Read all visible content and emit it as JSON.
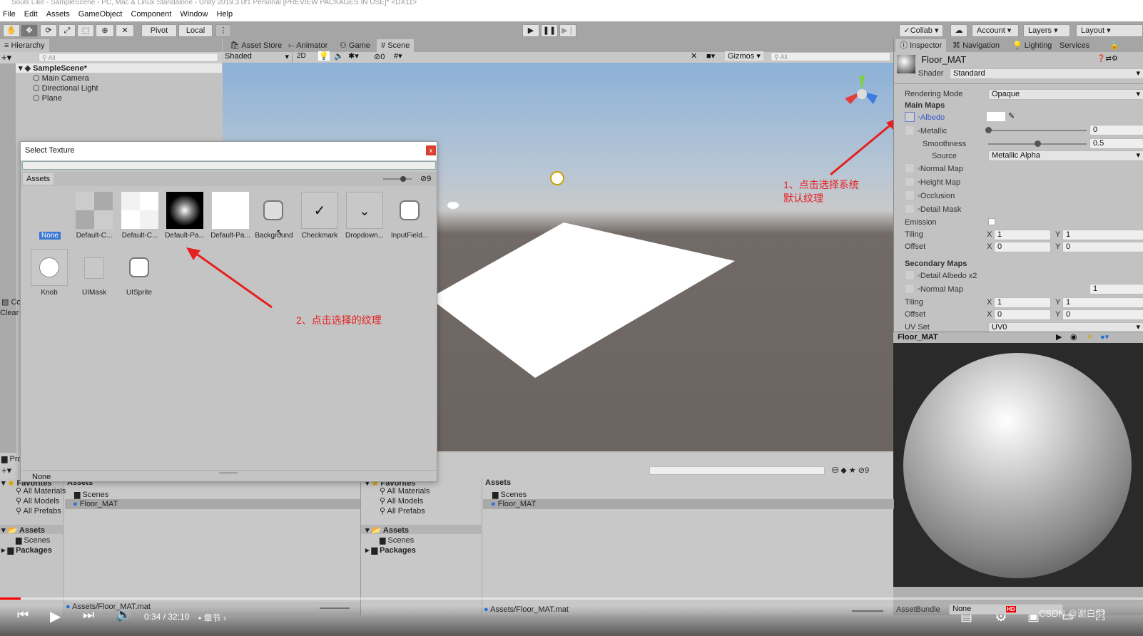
{
  "window": {
    "title": "Souls Like - SampleScene - PC, Mac & Linux Standalone - Unity 2019.3.0f1 Personal [PREVIEW PACKAGES IN USE]* <DX11>"
  },
  "menu": [
    "File",
    "Edit",
    "Assets",
    "GameObject",
    "Component",
    "Window",
    "Help"
  ],
  "toolbar": {
    "pivot": "Pivot",
    "local": "Local",
    "collab": "Collab",
    "account": "Account",
    "layers": "Layers",
    "layout": "Layout"
  },
  "hierarchy": {
    "tab": "Hierarchy",
    "search_placeholder": "All",
    "scene": "SampleScene*",
    "items": [
      "Main Camera",
      "Directional Light",
      "Plane"
    ]
  },
  "scene_tabs": [
    "Asset Store",
    "Animator",
    "Game",
    "Scene"
  ],
  "scene_toolbar": {
    "shading": "Shaded",
    "mode_2d": "2D",
    "hidden_count": "0",
    "gizmos": "Gizmos",
    "search_placeholder": "All"
  },
  "dialog": {
    "title": "Select Texture",
    "close": "x",
    "tab": "Assets",
    "count": "9",
    "footer": "None",
    "items": [
      "None",
      "Default-C...",
      "Default-C...",
      "Default-Pa...",
      "Default-Pa...",
      "Background",
      "Checkmark",
      "Dropdown...",
      "InputField...",
      "Knob",
      "UIMask",
      "UISprite"
    ]
  },
  "annotations": {
    "step1_line1": "1、点击选择系统",
    "step1_line2": "默认纹理",
    "step2": "2、点击选择的纹理",
    "color": "#e62020"
  },
  "inspector": {
    "tabs": [
      "Inspector",
      "Navigation",
      "Lighting",
      "Services"
    ],
    "name": "Floor_MAT",
    "shader_label": "Shader",
    "shader": "Standard",
    "rendering_mode_label": "Rendering Mode",
    "rendering_mode": "Opaque",
    "main_maps": "Main Maps",
    "albedo": "Albedo",
    "metallic": "Metallic",
    "metallic_value": "0",
    "smoothness": "Smoothness",
    "smoothness_value": "0.5",
    "source_label": "Source",
    "source": "Metallic Alpha",
    "normal_map": "Normal Map",
    "height_map": "Height Map",
    "occlusion": "Occlusion",
    "detail_mask": "Detail Mask",
    "emission": "Emission",
    "tiling": "Tiling",
    "offset": "Offset",
    "x": "X",
    "y": "Y",
    "tiling_x": "1",
    "tiling_y": "1",
    "offset_x": "0",
    "offset_y": "0",
    "secondary_maps": "Secondary Maps",
    "detail_albedo": "Detail Albedo x2",
    "normal_map2": "Normal Map",
    "normal_scale": "1",
    "tiling2_x": "1",
    "tiling2_y": "1",
    "offset2_x": "0",
    "offset2_y": "0",
    "uv_set_label": "UV Set",
    "uv_set": "UV0",
    "preview_title": "Floor_MAT",
    "assetbundle_label": "AssetBundle",
    "assetbundle": "None"
  },
  "project": {
    "tab": "Pro",
    "clear": "Clear",
    "console": "Co",
    "favorites": "Favorites",
    "fav_items": [
      "All Materials",
      "All Models",
      "All Prefabs"
    ],
    "assets": "Assets",
    "asset_folders": [
      "Scenes"
    ],
    "packages": "Packages",
    "content_header": "Assets",
    "content": [
      "Scenes",
      "Floor_MAT"
    ],
    "path": "Assets/Floor_MAT.mat",
    "count": "9"
  },
  "player": {
    "time": "0:34 / 32:10",
    "chapter": "• 章节",
    "progress": 0.018,
    "hd": "HD",
    "watermark": "CSDN @谢白羽"
  }
}
